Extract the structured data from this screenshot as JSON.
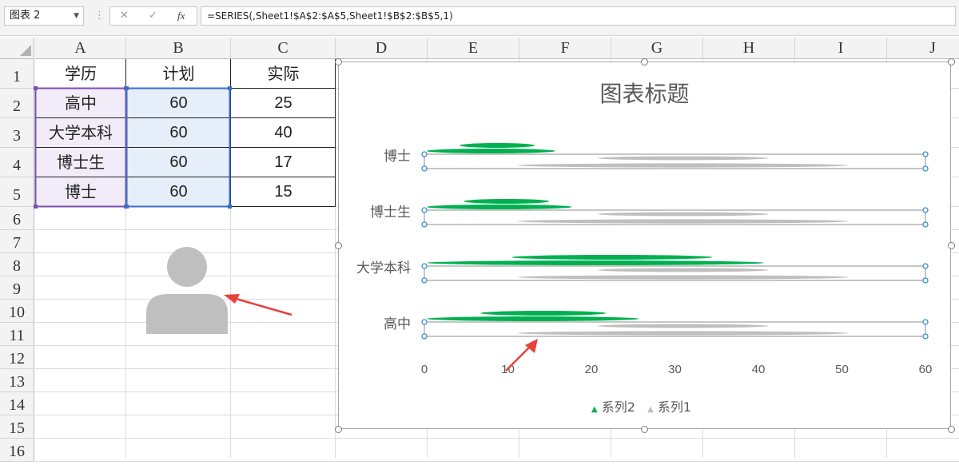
{
  "formula_bar": {
    "name_box": "图表 2",
    "cancel_glyph": "✕",
    "enter_glyph": "✓",
    "fx_glyph": "fx",
    "formula": "=SERIES(,Sheet1!$A$2:$A$5,Sheet1!$B$2:$B$5,1)"
  },
  "columns": [
    "A",
    "B",
    "C",
    "D",
    "E",
    "F",
    "G",
    "H",
    "I",
    "J"
  ],
  "rows": [
    "1",
    "2",
    "3",
    "4",
    "5",
    "6",
    "7",
    "8",
    "9",
    "10",
    "11",
    "12",
    "13",
    "14",
    "15",
    "16"
  ],
  "table": {
    "headers": [
      "学历",
      "计划",
      "实际"
    ],
    "data": [
      [
        "高中",
        "60",
        "25"
      ],
      [
        "大学本科",
        "60",
        "40"
      ],
      [
        "博士生",
        "60",
        "17"
      ],
      [
        "博士",
        "60",
        "15"
      ]
    ]
  },
  "person_icon_color": "#bfbfbf",
  "chart_data": {
    "type": "bar",
    "title": "图表标题",
    "orientation": "horizontal",
    "categories": [
      "博士",
      "博士生",
      "大学本科",
      "高中"
    ],
    "series": [
      {
        "name": "系列2",
        "values": [
          15,
          17,
          40,
          25
        ],
        "color": "#00b050"
      },
      {
        "name": "系列1",
        "values": [
          60,
          60,
          60,
          60
        ],
        "color": "#bfbfbf"
      }
    ],
    "xlim": [
      0,
      60
    ],
    "xticks": [
      "0",
      "10",
      "20",
      "30",
      "40",
      "50",
      "60"
    ],
    "grid": false,
    "legend": "bottom"
  },
  "colors": {
    "accent_arrow": "#e8413a",
    "selection_purple": "#7a4fb0",
    "selection_blue": "#3a6fc9"
  }
}
